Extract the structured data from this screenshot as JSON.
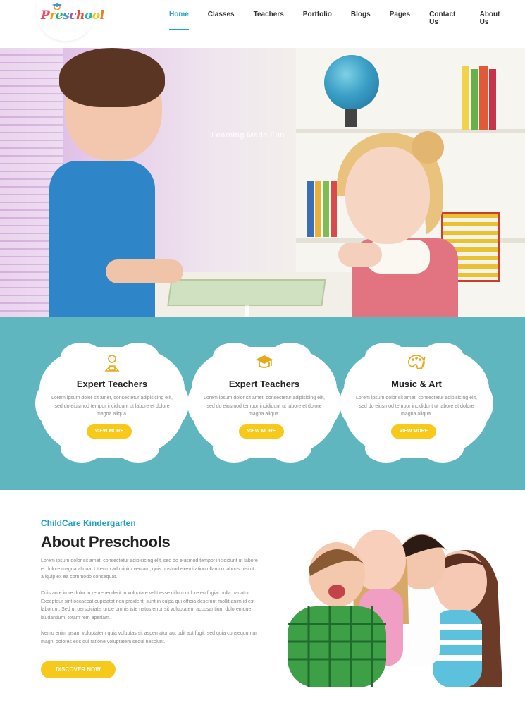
{
  "brand": {
    "logo_text": "Preschool",
    "logo_colors": [
      "#e94b6a",
      "#f39c12",
      "#27ae60",
      "#3498db",
      "#9b59b6",
      "#e74c3c",
      "#1abc9c",
      "#f1c40f",
      "#e67e22"
    ]
  },
  "nav": {
    "items": [
      "Home",
      "Classes",
      "Teachers",
      "Portfolio",
      "Blogs",
      "Pages",
      "Contact Us",
      "About Us"
    ],
    "active": "Home"
  },
  "hero": {
    "caption": "Learning Made Fun",
    "slides": 3,
    "active_slide": 2
  },
  "features": [
    {
      "icon": "teacher-icon",
      "title": "Expert Teachers",
      "text": "Lorem ipsum dolor sit amet, consectetur adipisicing elit, sed do eiusmod tempor incididunt ut labore et dolore magna aliqua.",
      "button": "VIEW MORE"
    },
    {
      "icon": "graduation-cap-icon",
      "title": "Expert Teachers",
      "text": "Lorem ipsum dolor sit amet, consectetur adipisicing elit, sed do eiusmod tempor incididunt ut labore et dolore magna aliqua.",
      "button": "VIEW MORE"
    },
    {
      "icon": "palette-icon",
      "title": "Music & Art",
      "text": "Lorem ipsum dolor sit amet, consectetur adipisicing elit, sed do eiusmod tempor incididunt ut labore et dolore magna aliqua.",
      "button": "VIEW MORE"
    }
  ],
  "about": {
    "subtitle": "ChildCare Kindergarten",
    "title": "About Preschools",
    "paragraphs": [
      "Lorem ipsum dolor sit amet, consectetur adipisicing elit, sed do eiusmod tempor incididunt ut labore et dolore magna aliqua. Ut enim ad minim veniam, quis nostrud exercitation ullamco laboris nisi ut aliquip ex ea commodo consequat.",
      "Duis aute irure dolor in reprehenderit in voluptate velit esse cillum dolore eu fugiat nulla pariatur. Excepteur sint occaecat cupidatat non proident, sunt in culpa qui officia deserunt mollit anim id est laborum. Sed ut perspiciatis unde omnis iste natus error sit voluptatem accusantium doloremque laudantium, totam rem aperiam.",
      "Nemo enim ipsam voluptatem quia voluptas sit aspernatur aut odit aut fugit, sed quia consequuntur magni dolores eos qui ratione voluptatem sequi nesciunt."
    ],
    "button": "DISCOVER NOW"
  },
  "colors": {
    "accent": "#1ea1c7",
    "teal_band": "#5fb6be",
    "button_yellow": "#f7c91b"
  }
}
